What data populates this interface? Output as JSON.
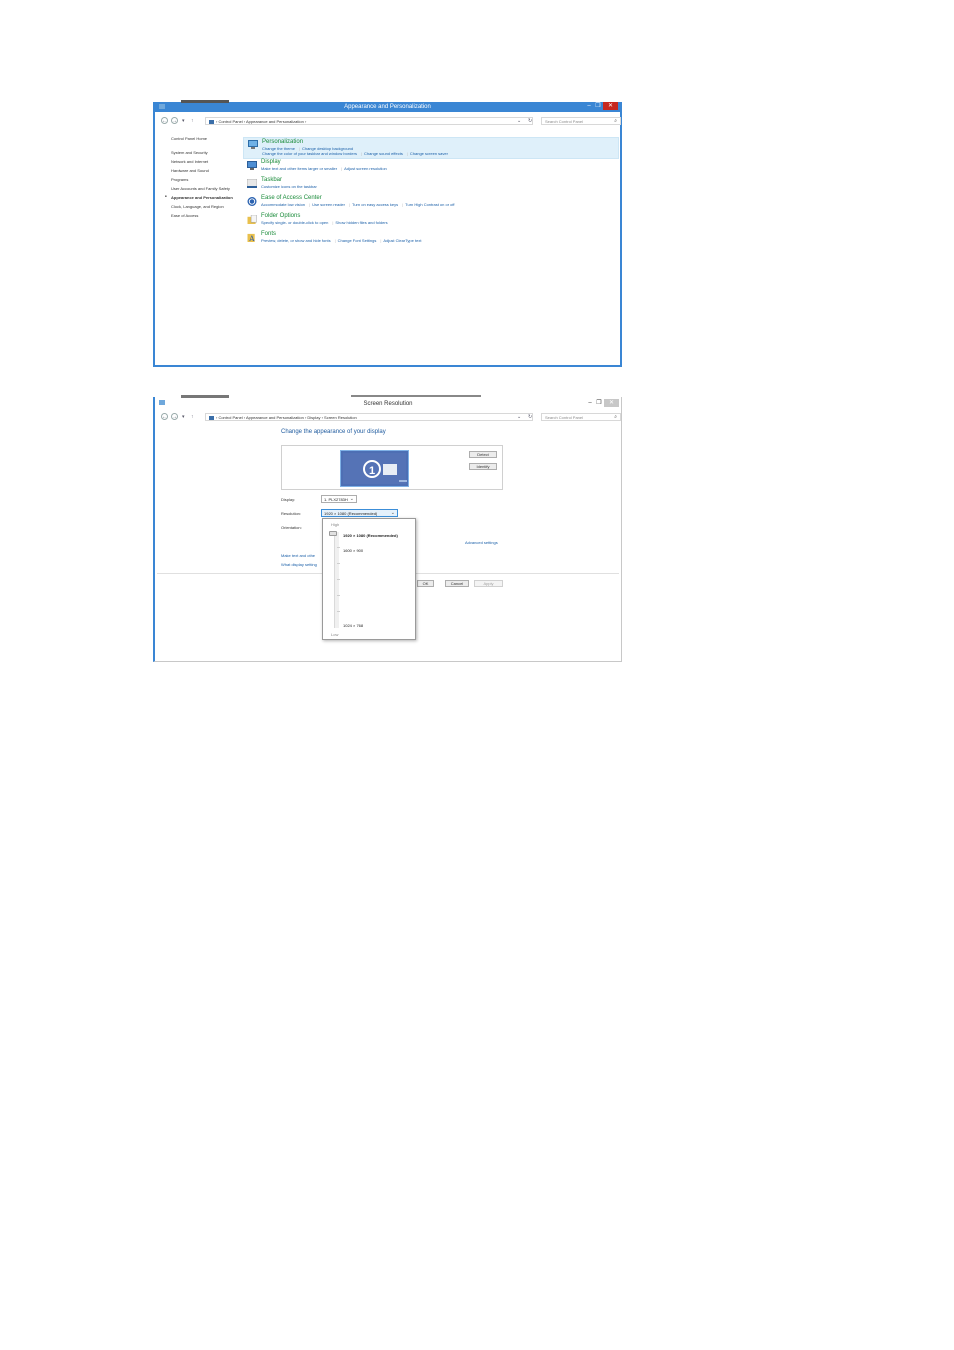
{
  "window1": {
    "title": "Appearance and Personalization",
    "minimize": "–",
    "maximize": "❐",
    "close": "✕",
    "address": {
      "back": "←",
      "forward": "→",
      "recent": "▾",
      "up": "↑",
      "path": "› Control Panel › Appearance and Personalization ›",
      "dropdown": "⌄",
      "refresh": "↻"
    },
    "search": {
      "placeholder": "Search Control Panel",
      "icon": "search-icon"
    },
    "sidebar": {
      "home": "Control Panel Home",
      "items": [
        "System and Security",
        "Network and Internet",
        "Hardware and Sound",
        "Programs",
        "User Accounts and Family Safety",
        "Appearance and Personalization",
        "Clock, Language, and Region",
        "Ease of Access"
      ],
      "current_index": 5
    },
    "categories": [
      {
        "title": "Personalization",
        "icon": "personalization-icon",
        "links": [
          "Change the theme",
          "Change desktop background",
          "Change the color of your taskbar and window borders",
          "Change sound effects",
          "Change screen saver"
        ]
      },
      {
        "title": "Display",
        "icon": "display-icon",
        "links": [
          "Make text and other items larger or smaller",
          "Adjust screen resolution"
        ]
      },
      {
        "title": "Taskbar",
        "icon": "taskbar-icon",
        "links": [
          "Customize icons on the taskbar"
        ]
      },
      {
        "title": "Ease of Access Center",
        "icon": "ease-of-access-icon",
        "links": [
          "Accommodate low vision",
          "Use screen reader",
          "Turn on easy access keys",
          "Turn High Contrast on or off"
        ]
      },
      {
        "title": "Folder Options",
        "icon": "folder-options-icon",
        "links": [
          "Specify single- or double-click to open",
          "Show hidden files and folders"
        ]
      },
      {
        "title": "Fonts",
        "icon": "fonts-icon",
        "links": [
          "Preview, delete, or show and hide fonts",
          "Change Font Settings",
          "Adjust ClearType text"
        ]
      }
    ]
  },
  "window2": {
    "title": "Screen Resolution",
    "minimize": "–",
    "maximize": "❐",
    "close": "✕",
    "address": {
      "back": "←",
      "forward": "→",
      "recent": "▾",
      "up": "↑",
      "path": "› Control Panel › Appearance and Personalization › Display › Screen Resolution",
      "dropdown": "⌄",
      "refresh": "↻"
    },
    "search": {
      "placeholder": "Search Control Panel",
      "icon": "search-icon"
    },
    "heading": "Change the appearance of your display",
    "monitor_number": "1",
    "detect": "Detect",
    "identify": "Identify",
    "display_label": "Display:",
    "display_value": "1. PLX2783H",
    "resolution_label": "Resolution:",
    "resolution_value": "1920 × 1080 (Recommended)",
    "orientation_label": "Orientation:",
    "advanced": "Advanced settings",
    "link1": "Make text and othe",
    "link2": "What display setting",
    "ok": "OK",
    "cancel": "Cancel",
    "apply": "Apply",
    "dropdown": {
      "high": "High",
      "low": "Low",
      "options": [
        "1920 × 1080 (Recommended)",
        "1600 × 900",
        "1024 × 768"
      ],
      "selected_index": 0
    }
  }
}
